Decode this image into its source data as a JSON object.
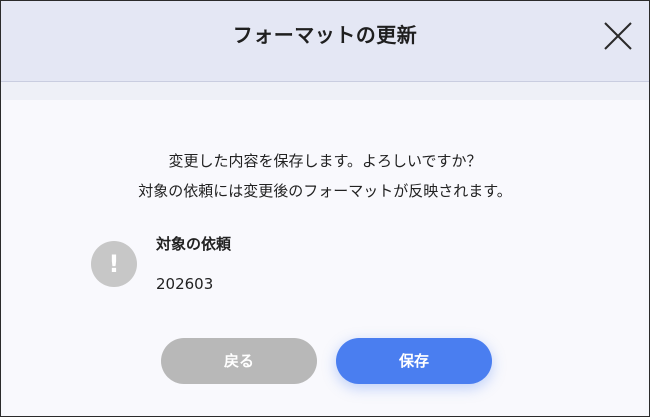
{
  "dialog": {
    "title": "フォーマットの更新",
    "close_icon": "close-icon"
  },
  "message": {
    "line1": "変更した内容を保存します。よろしいですか？",
    "line2": "対象の依頼には変更後のフォーマットが反映されます。"
  },
  "target": {
    "icon": "exclamation-icon",
    "icon_glyph": "!",
    "label": "対象の依頼",
    "value": "202603"
  },
  "buttons": {
    "back_label": "戻る",
    "save_label": "保存"
  },
  "colors": {
    "header_bg": "#e4e7f4",
    "body_bg": "#f9f9fd",
    "primary": "#4a7ef0",
    "secondary": "#b8b8b8",
    "icon_bg": "#c7c7c7"
  }
}
